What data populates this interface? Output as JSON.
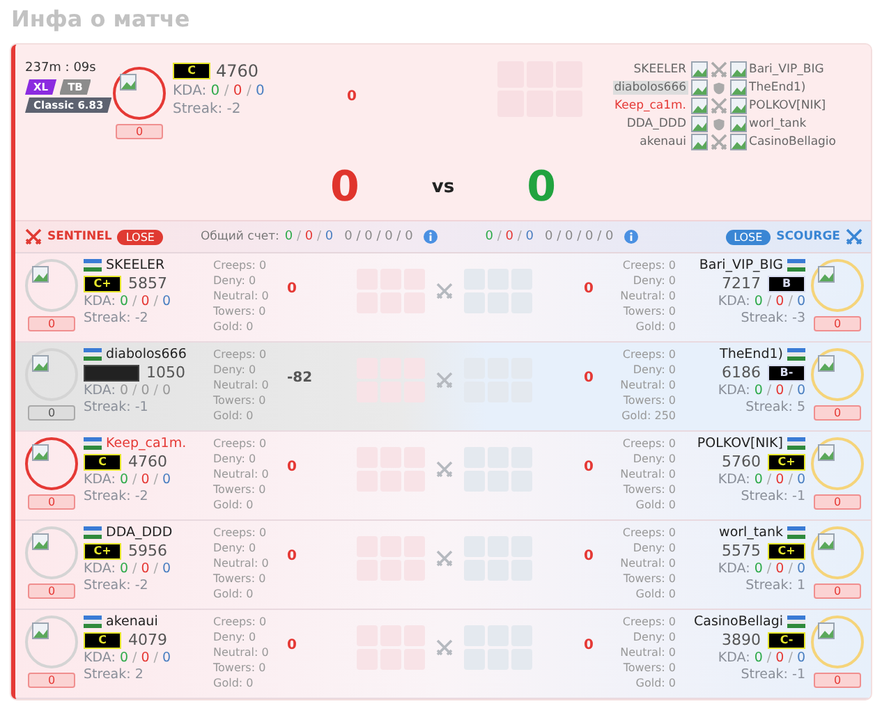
{
  "title": "Инфа о матче",
  "separator": "/",
  "header": {
    "time": "237m : 09s",
    "tags": [
      {
        "label": "XL",
        "color": "#8b2be0"
      },
      {
        "label": "TB",
        "color": "#8c8c8c"
      },
      {
        "label": "Classic 6.83",
        "color": "#5d6270"
      }
    ],
    "player": {
      "rank": "C",
      "color": "#e6e62a",
      "rating": "4760",
      "kda_label": "KDA:",
      "kda": [
        "0",
        "0",
        "0"
      ],
      "streak": "Streak: -2",
      "badge": "0",
      "self": true,
      "diff": "0"
    },
    "roster": [
      {
        "left": "SKEELER",
        "right": "Bari_VIP_BIG",
        "kind": "swords",
        "self": false,
        "disconnected": false
      },
      {
        "left": "diabolos666",
        "right": "TheEnd1)",
        "kind": "shield",
        "self": false,
        "disconnected": true
      },
      {
        "left": "Keep_ca1m.",
        "right": "POLKOV[NIK]",
        "kind": "swords",
        "self": true,
        "disconnected": false
      },
      {
        "left": "DDA_DDD",
        "right": "worl_tank",
        "kind": "shield",
        "self": false,
        "disconnected": false
      },
      {
        "left": "akenaui",
        "right": "CasinoBellagio",
        "kind": "swords",
        "self": false,
        "disconnected": false
      }
    ],
    "scores": [
      {
        "value": "0",
        "color": "#e0342c"
      },
      {
        "value": "0",
        "color": "#21a33f"
      }
    ],
    "vs": "vs"
  },
  "totals_label": "Общий счет:",
  "teams": [
    {
      "kind": "sentinel",
      "name": "SENTINEL",
      "result": "LOSE",
      "kda": [
        "0",
        "0",
        "0"
      ],
      "extra": [
        "0",
        "0",
        "0",
        "0"
      ]
    },
    {
      "kind": "scourge",
      "name": "SCOURGE",
      "result": "LOSE",
      "kda": [
        "0",
        "0",
        "0"
      ],
      "extra": [
        "0",
        "0",
        "0",
        "0"
      ]
    }
  ],
  "rows": [
    {
      "kind": "swords",
      "left": {
        "name": "SKEELER",
        "rank": "C+",
        "color": "#e6e62a",
        "rating": "5857",
        "kda_label": "KDA:",
        "kda": [
          "0",
          "0",
          "0"
        ],
        "streak": "Streak: -2",
        "badge": "0",
        "stats": [
          "Creeps: 0",
          "Deny: 0",
          "Neutral: 0",
          "Towers: 0",
          "Gold: 0"
        ],
        "diff": "0",
        "self": false,
        "disconnected": false
      },
      "right": {
        "name": "Bari_VIP_BIG",
        "rank": "B",
        "color": "#d8dcf0",
        "rating": "7217",
        "kda_label": "KDA:",
        "kda": [
          "0",
          "0",
          "0"
        ],
        "streak": "Streak: -3",
        "badge": "0",
        "stats": [
          "Creeps: 0",
          "Deny: 0",
          "Neutral: 0",
          "Towers: 0",
          "Gold: 0"
        ],
        "diff": "0",
        "self": false,
        "disconnected": false
      }
    },
    {
      "kind": "swords",
      "left": {
        "name": "diabolos666",
        "rating": "1050",
        "kda_label": "KDA:",
        "kda": [
          "0",
          "0",
          "0"
        ],
        "streak": "Streak: -1",
        "badge": "0",
        "stats": [
          "Creeps: 0",
          "Deny: 0",
          "Neutral: 0",
          "Towers: 0",
          "Gold: 0"
        ],
        "diff": "-82",
        "self": false,
        "disconnected": true
      },
      "right": {
        "name": "TheEnd1)",
        "rank": "B-",
        "color": "#d8dcf0",
        "rating": "6186",
        "kda_label": "KDA:",
        "kda": [
          "0",
          "0",
          "0"
        ],
        "streak": "Streak: 5",
        "badge": "0",
        "stats": [
          "Creeps: 0",
          "Deny: 0",
          "Neutral: 0",
          "Towers: 0",
          "Gold: 250"
        ],
        "diff": "0",
        "self": false,
        "disconnected": false
      }
    },
    {
      "kind": "swords",
      "left": {
        "name": "Keep_ca1m.",
        "rank": "C",
        "color": "#e6e62a",
        "rating": "4760",
        "kda_label": "KDA:",
        "kda": [
          "0",
          "0",
          "0"
        ],
        "streak": "Streak: -2",
        "badge": "0",
        "stats": [
          "Creeps: 0",
          "Deny: 0",
          "Neutral: 0",
          "Towers: 0",
          "Gold: 0"
        ],
        "diff": "0",
        "self": true,
        "disconnected": false
      },
      "right": {
        "name": "POLKOV[NIK]",
        "rank": "C+",
        "color": "#e6e62a",
        "rating": "5760",
        "kda_label": "KDA:",
        "kda": [
          "0",
          "0",
          "0"
        ],
        "streak": "Streak: -1",
        "badge": "0",
        "stats": [
          "Creeps: 0",
          "Deny: 0",
          "Neutral: 0",
          "Towers: 0",
          "Gold: 0"
        ],
        "diff": "0",
        "self": false,
        "disconnected": false
      }
    },
    {
      "kind": "swords",
      "left": {
        "name": "DDA_DDD",
        "rank": "C+",
        "color": "#e6e62a",
        "rating": "5956",
        "kda_label": "KDA:",
        "kda": [
          "0",
          "0",
          "0"
        ],
        "streak": "Streak: -2",
        "badge": "0",
        "stats": [
          "Creeps: 0",
          "Deny: 0",
          "Neutral: 0",
          "Towers: 0",
          "Gold: 0"
        ],
        "diff": "0",
        "self": false,
        "disconnected": false
      },
      "right": {
        "name": "worl_tank",
        "rank": "C+",
        "color": "#e6e62a",
        "rating": "5575",
        "kda_label": "KDA:",
        "kda": [
          "0",
          "0",
          "0"
        ],
        "streak": "Streak: 1",
        "badge": "0",
        "stats": [
          "Creeps: 0",
          "Deny: 0",
          "Neutral: 0",
          "Towers: 0",
          "Gold: 0"
        ],
        "diff": "0",
        "self": false,
        "disconnected": false
      }
    },
    {
      "kind": "swords",
      "left": {
        "name": "akenaui",
        "rank": "C",
        "color": "#e6e62a",
        "rating": "4079",
        "kda_label": "KDA:",
        "kda": [
          "0",
          "0",
          "0"
        ],
        "streak": "Streak: 2",
        "badge": "0",
        "stats": [
          "Creeps: 0",
          "Deny: 0",
          "Neutral: 0",
          "Towers: 0",
          "Gold: 0"
        ],
        "diff": "0",
        "self": false,
        "disconnected": false
      },
      "right": {
        "name": "CasinoBellagi",
        "rank": "C-",
        "color": "#e6e62a",
        "rating": "3890",
        "kda_label": "KDA:",
        "kda": [
          "0",
          "0",
          "0"
        ],
        "streak": "Streak: -1",
        "badge": "0",
        "stats": [
          "Creeps: 0",
          "Deny: 0",
          "Neutral: 0",
          "Towers: 0",
          "Gold: 0"
        ],
        "diff": "0",
        "self": false,
        "disconnected": false
      }
    }
  ]
}
